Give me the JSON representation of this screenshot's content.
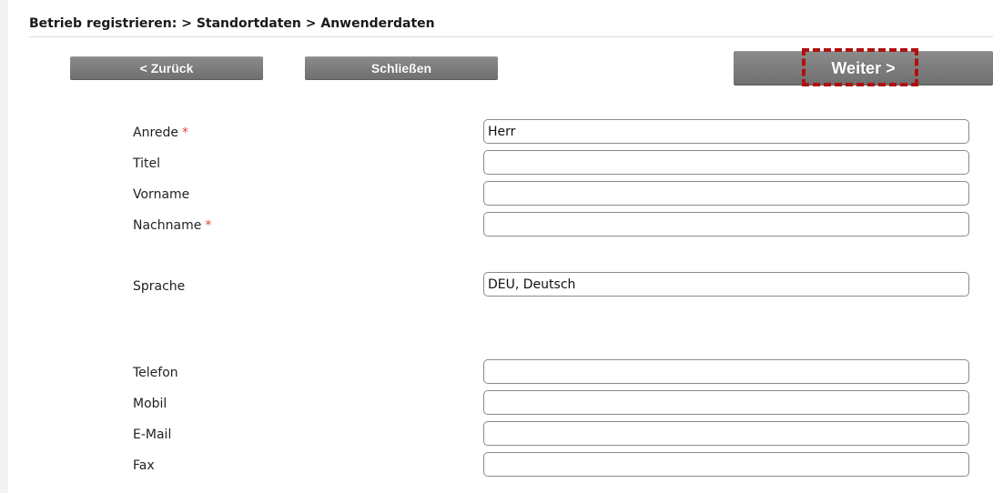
{
  "breadcrumb": "Betrieb registrieren: > Standortdaten > Anwenderdaten",
  "buttons": {
    "back": "< Zurück",
    "close": "Schließen",
    "next": "Weiter >"
  },
  "fields": {
    "anrede": {
      "label": "Anrede",
      "required_mark": "*",
      "value": "Herr"
    },
    "titel": {
      "label": "Titel",
      "value": ""
    },
    "vorname": {
      "label": "Vorname",
      "value": ""
    },
    "nachname": {
      "label": "Nachname",
      "required_mark": "*",
      "value": ""
    },
    "sprache": {
      "label": "Sprache",
      "value": "DEU, Deutsch"
    },
    "telefon": {
      "label": "Telefon",
      "value": ""
    },
    "mobil": {
      "label": "Mobil",
      "value": ""
    },
    "email": {
      "label": "E-Mail",
      "value": ""
    },
    "fax": {
      "label": "Fax",
      "value": ""
    }
  },
  "colors": {
    "button_bg": "#7a7a7a",
    "required_star": "#e8433c",
    "highlight_border": "#b01010"
  }
}
